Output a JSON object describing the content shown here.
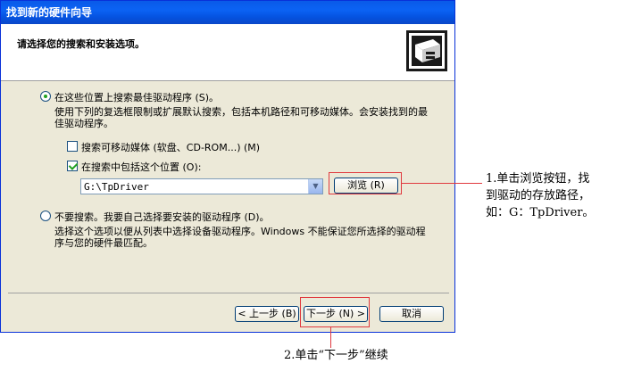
{
  "window": {
    "title": "找到新的硬件向导",
    "header_title": "请选择您的搜索和安装选项。"
  },
  "options": {
    "search_best": {
      "label": "在这些位置上搜索最佳驱动程序 (S)。",
      "description": "使用下列的复选框限制或扩展默认搜索，包括本机路径和可移动媒体。会安装找到的最佳驱动程序。",
      "selected": true
    },
    "search_removable": {
      "label": "搜索可移动媒体 (软盘、CD-ROM...) (M)",
      "checked": false
    },
    "include_location": {
      "label": "在搜索中包括这个位置 (O):",
      "checked": true
    },
    "location_value": "G:\\TpDriver",
    "browse_label": "浏览 (R)",
    "no_search": {
      "label": "不要搜索。我要自己选择要安装的驱动程序 (D)。",
      "description": "选择这个选项以便从列表中选择设备驱动程序。Windows 不能保证您所选择的驱动程序与您的硬件最匹配。",
      "selected": false
    }
  },
  "footer": {
    "back_label": "< 上一步 (B)",
    "next_label": "下一步 (N) >",
    "cancel_label": "取消"
  },
  "annotations": {
    "browse_note_lines": [
      "1.单击浏览按钮，找",
      "到驱动的存放路径，",
      "如：G：TpDriver。"
    ],
    "next_note": "2.单击“下一步”继续"
  },
  "colors": {
    "title_bar": "#0a5ae8",
    "dialog_bg": "#ece9d8",
    "highlight": "#e0393e"
  }
}
